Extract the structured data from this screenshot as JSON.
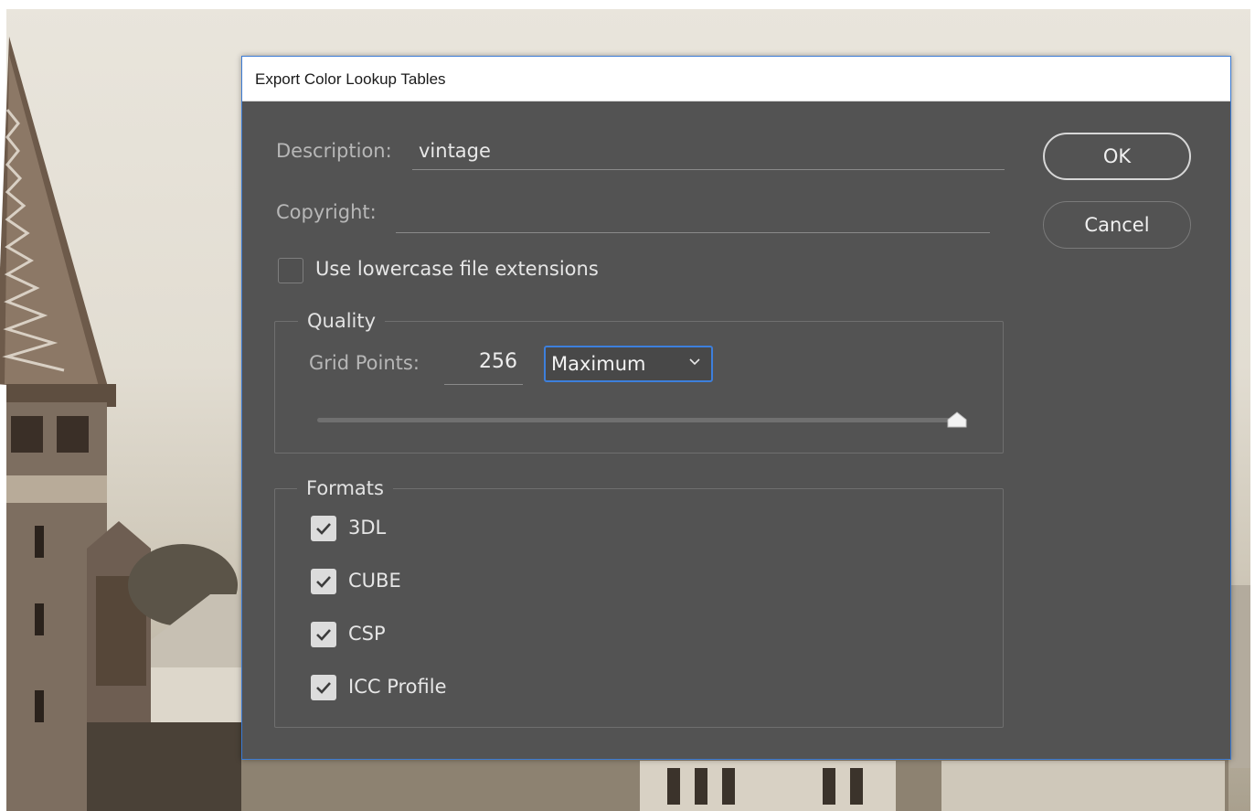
{
  "dialog": {
    "title": "Export Color Lookup Tables",
    "description": {
      "label": "Description:",
      "value": "vintage"
    },
    "copyright": {
      "label": "Copyright:",
      "value": ""
    },
    "lowercase_ext": {
      "label": "Use lowercase file extensions",
      "checked": false
    },
    "quality": {
      "legend": "Quality",
      "grid_points_label": "Grid Points:",
      "grid_points_value": "256",
      "preset_selected": "Maximum",
      "slider_level": 1.0
    },
    "formats": {
      "legend": "Formats",
      "items": [
        {
          "label": "3DL",
          "checked": true
        },
        {
          "label": "CUBE",
          "checked": true
        },
        {
          "label": "CSP",
          "checked": true
        },
        {
          "label": "ICC Profile",
          "checked": true
        }
      ]
    },
    "buttons": {
      "ok": "OK",
      "cancel": "Cancel"
    }
  },
  "colors": {
    "dialog_bg": "#535353",
    "accent": "#3d7fdc"
  }
}
